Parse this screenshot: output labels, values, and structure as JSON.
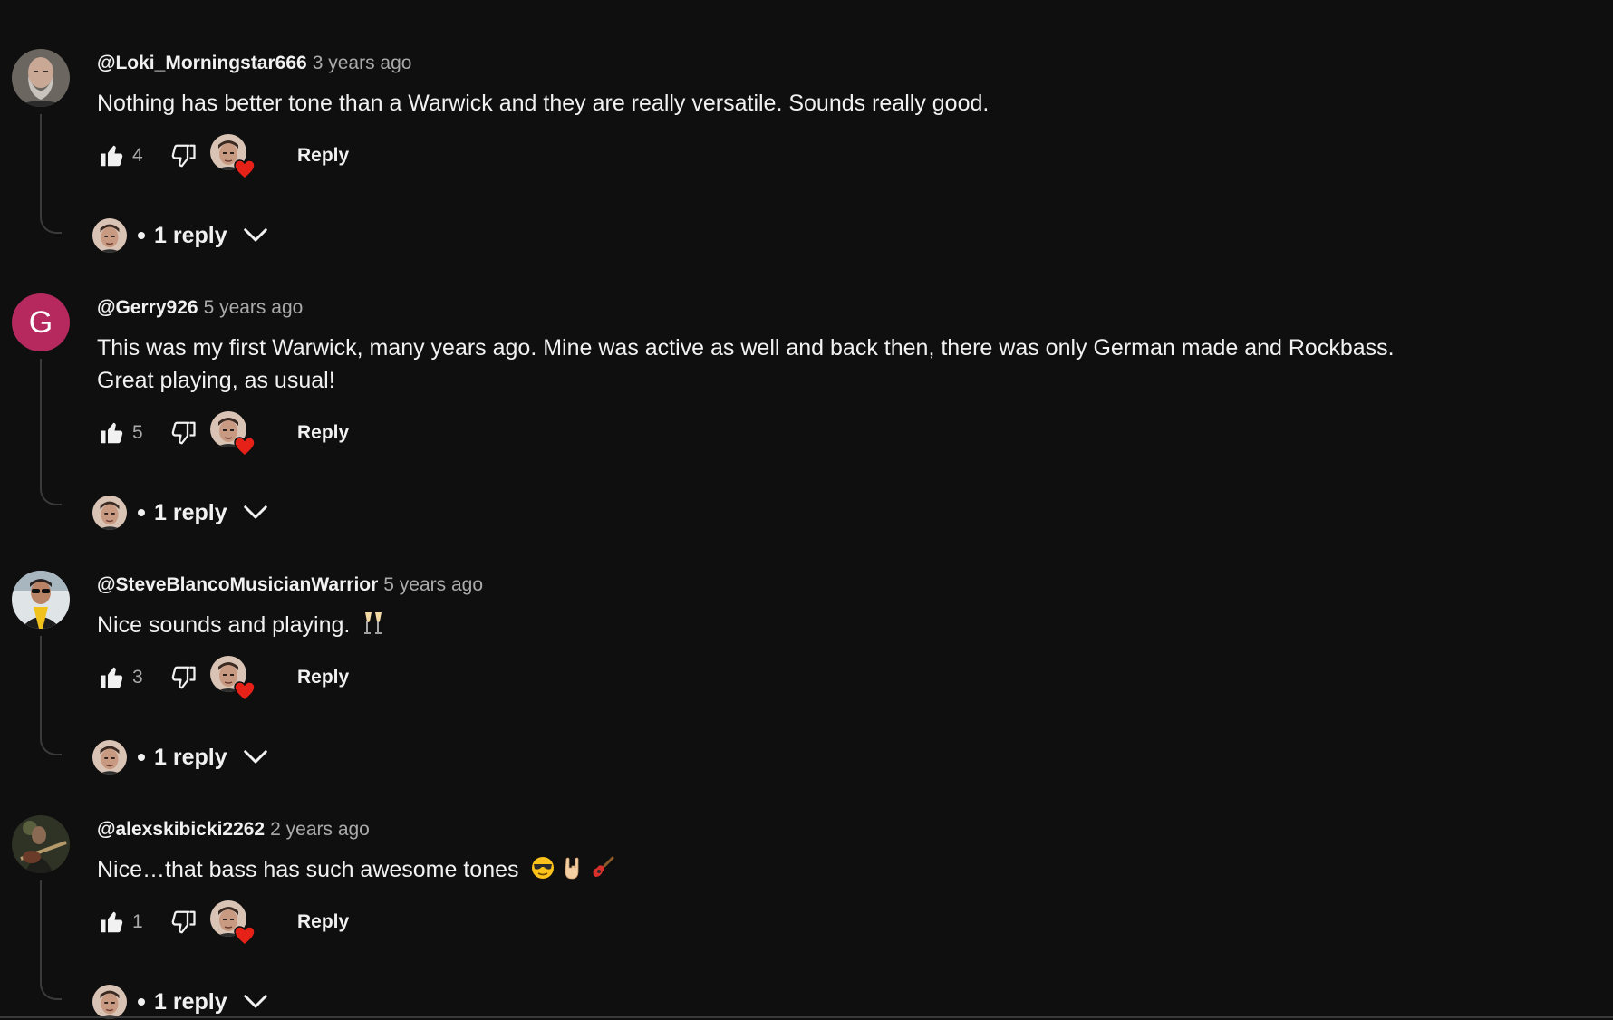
{
  "comments": [
    {
      "author": "@Loki_Morningstar666",
      "time": "3 years ago",
      "text_lines": [
        "Nothing has better tone than a Warwick and they are really versatile. Sounds really good."
      ],
      "likes": "4",
      "reply_label": "Reply",
      "replies_label": "1 reply",
      "avatar": "photo-bearded-man"
    },
    {
      "author": "@Gerry926",
      "time": "5 years ago",
      "text_lines": [
        "This was my first Warwick, many years ago. Mine was active as well and back then, there was only German made and Rockbass.",
        "Great playing, as usual!"
      ],
      "likes": "5",
      "reply_label": "Reply",
      "replies_label": "1 reply",
      "avatar_letter": "G",
      "avatar_color": "#b5295e"
    },
    {
      "author": "@SteveBlancoMusicianWarrior",
      "time": "5 years ago",
      "text_lines": [
        "Nice sounds and playing. "
      ],
      "text_emojis": [
        "champagne-glasses-emoji"
      ],
      "likes": "3",
      "reply_label": "Reply",
      "replies_label": "1 reply",
      "avatar": "photo-man-sunglasses-yellow"
    },
    {
      "author": "@alexskibicki2262",
      "time": "2 years ago",
      "text_lines": [
        "Nice…that bass has such awesome tones "
      ],
      "text_emojis": [
        "sunglasses-face-emoji",
        "rock-hand-emoji",
        "guitar-emoji"
      ],
      "likes": "1",
      "reply_label": "Reply",
      "replies_label": "1 reply",
      "avatar": "photo-bass-player"
    }
  ],
  "colors": {
    "background": "#0f0f0f",
    "text_primary": "#f1f1f1",
    "text_secondary": "#aaaaaa",
    "heart": "#e62117",
    "thread_line": "#3a3a3a"
  },
  "icons": [
    "thumbs-up-icon",
    "thumbs-down-icon",
    "creator-heart-icon",
    "chevron-down-icon"
  ]
}
